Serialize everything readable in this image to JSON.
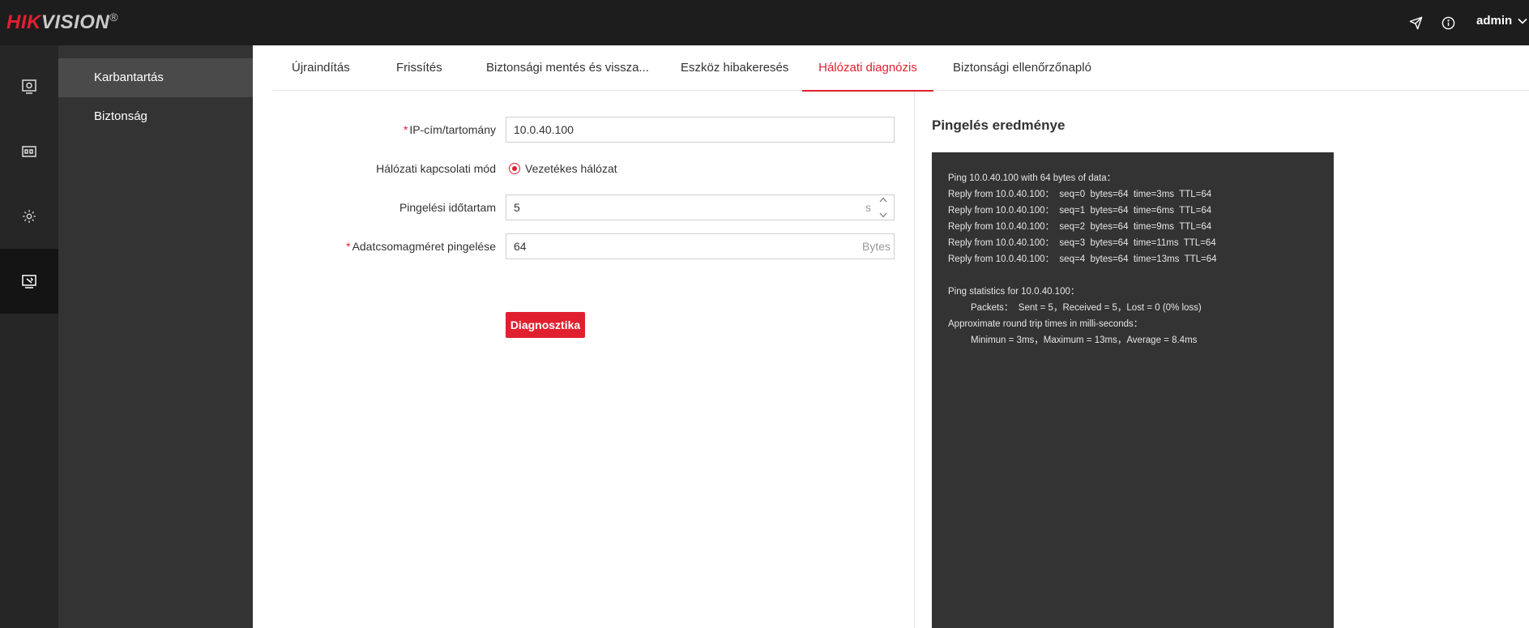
{
  "brand": {
    "logo_part1": "HIK",
    "logo_part2": "VISION",
    "logo_reg": "®"
  },
  "header": {
    "user": "admin"
  },
  "colors": {
    "accent": "#e0202f",
    "topbar": "#1d1d1d",
    "rail": "#262626",
    "subnav": "#333333",
    "console": "#333333"
  },
  "rail": {
    "items": [
      {
        "icon": "live-view-icon"
      },
      {
        "icon": "device-icon"
      },
      {
        "icon": "gear-icon"
      },
      {
        "icon": "maintenance-icon",
        "active": true
      }
    ]
  },
  "subnav": {
    "items": [
      {
        "label": "Karbantartás",
        "active": true
      },
      {
        "label": "Biztonság"
      }
    ]
  },
  "tabs": [
    {
      "label": "Újraindítás"
    },
    {
      "label": "Frissítés"
    },
    {
      "label": "Biztonsági mentés és vissza..."
    },
    {
      "label": "Eszköz hibakeresés"
    },
    {
      "label": "Hálózati diagnózis",
      "active": true
    },
    {
      "label": "Biztonsági ellenőrzőnapló"
    }
  ],
  "form": {
    "ip": {
      "label": "IP-cím/tartomány",
      "required": "*",
      "value": "10.0.40.100"
    },
    "mode": {
      "label": "Hálózati kapcsolati mód",
      "option": "Vezetékes hálózat"
    },
    "duration": {
      "label": "Pingelési időtartam",
      "value": "5",
      "unit": "s"
    },
    "packet": {
      "label": "Adatcsomagméret pingelése",
      "required": "*",
      "value": "64",
      "unit": "Bytes"
    },
    "button": "Diagnosztika"
  },
  "result": {
    "title": "Pingelés eredménye",
    "lines": [
      "Ping 10.0.40.100 with 64 bytes of data：",
      "Reply from 10.0.40.100：  seq=0  bytes=64  time=3ms  TTL=64",
      "Reply from 10.0.40.100：  seq=1  bytes=64  time=6ms  TTL=64",
      "Reply from 10.0.40.100：  seq=2  bytes=64  time=9ms  TTL=64",
      "Reply from 10.0.40.100：  seq=3  bytes=64  time=11ms  TTL=64",
      "Reply from 10.0.40.100：  seq=4  bytes=64  time=13ms  TTL=64",
      "",
      "Ping statistics for 10.0.40.100：",
      "Packets：  Sent = 5，Received = 5，Lost = 0 (0% loss)",
      "Approximate round trip times in milli-seconds：",
      "Minimun = 3ms，Maximum = 13ms，Average = 8.4ms"
    ]
  }
}
